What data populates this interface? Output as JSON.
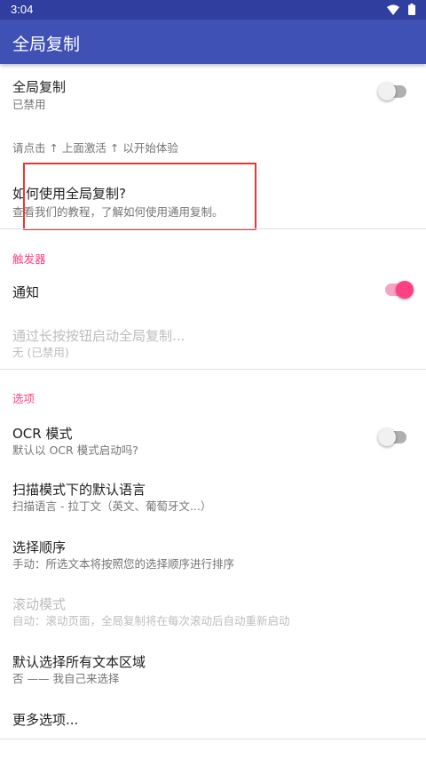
{
  "status_bar": {
    "time": "3:04",
    "icons": [
      "wifi-icon",
      "battery-icon"
    ]
  },
  "app_bar": {
    "title": "全局复制"
  },
  "global_copy": {
    "title": "全局复制",
    "summary": "已禁用",
    "enabled": false
  },
  "activation_hint": "请点击 ↑ 上面激活 ↑ 以开始体验",
  "how_to": {
    "title": "如何使用全局复制?",
    "summary": "查看我们的教程，了解如何使用通用复制。"
  },
  "triggers": {
    "header": "触发器",
    "notification": {
      "title": "通知",
      "enabled": true
    },
    "long_press": {
      "title": "通过长按按钮启动全局复制...",
      "summary": "无 (已禁用)"
    }
  },
  "options": {
    "header": "选项",
    "ocr_mode": {
      "title": "OCR 模式",
      "summary": "默认以 OCR 模式启动吗?",
      "enabled": false
    },
    "scan_language": {
      "title": "扫描模式下的默认语言",
      "summary": "扫描语言 - 拉丁文（英文、葡萄牙文...）"
    },
    "selection_order": {
      "title": "选择顺序",
      "summary": "手动：所选文本将按照您的选择顺序进行排序"
    },
    "scroll_mode": {
      "title": "滚动模式",
      "summary": "自动：滚动页面，全局复制将在每次滚动后自动重新启动"
    },
    "select_all": {
      "title": "默认选择所有文本区域",
      "summary": "否 —— 我自己来选择"
    },
    "more": {
      "title": "更多选项..."
    }
  },
  "colors": {
    "primary": "#3f51b5",
    "primary_dark": "#303f9f",
    "accent": "#ff4081",
    "highlight_box": "#e53935"
  }
}
